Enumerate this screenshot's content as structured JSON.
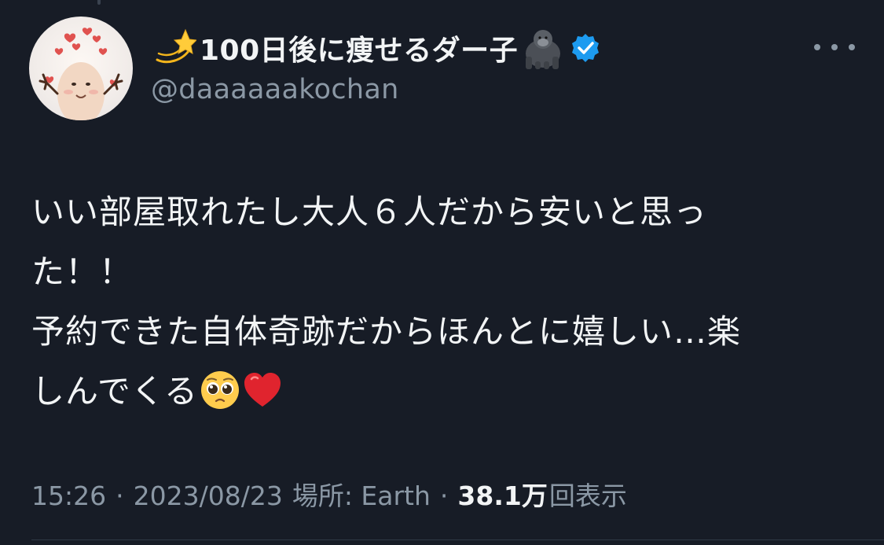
{
  "author": {
    "name_emoji": "dizzy-star-icon",
    "display_name": "100日後に痩せるダー子",
    "name_suffix_emoji": "gorilla-icon",
    "verified": true,
    "handle": "@daaaaaakochan"
  },
  "tweet": {
    "lines": [
      "いい部屋取れたし大人６人だから安いと思っ",
      "た！！",
      "予約できた自体奇跡だからほんとに嬉しい…楽",
      "しんでくる"
    ],
    "trailing_emojis": [
      "pleading-face-icon",
      "red-heart-icon"
    ]
  },
  "meta": {
    "time": "15:26",
    "separator": "·",
    "date": "2023/08/23",
    "location": "場所: Earth",
    "views_count": "38.1万",
    "views_label": "回表示"
  },
  "colors": {
    "background": "#171c26",
    "primary_text": "#f2f4f5",
    "secondary_text": "#8b98a5",
    "verified_badge": "#1d9bf0"
  }
}
